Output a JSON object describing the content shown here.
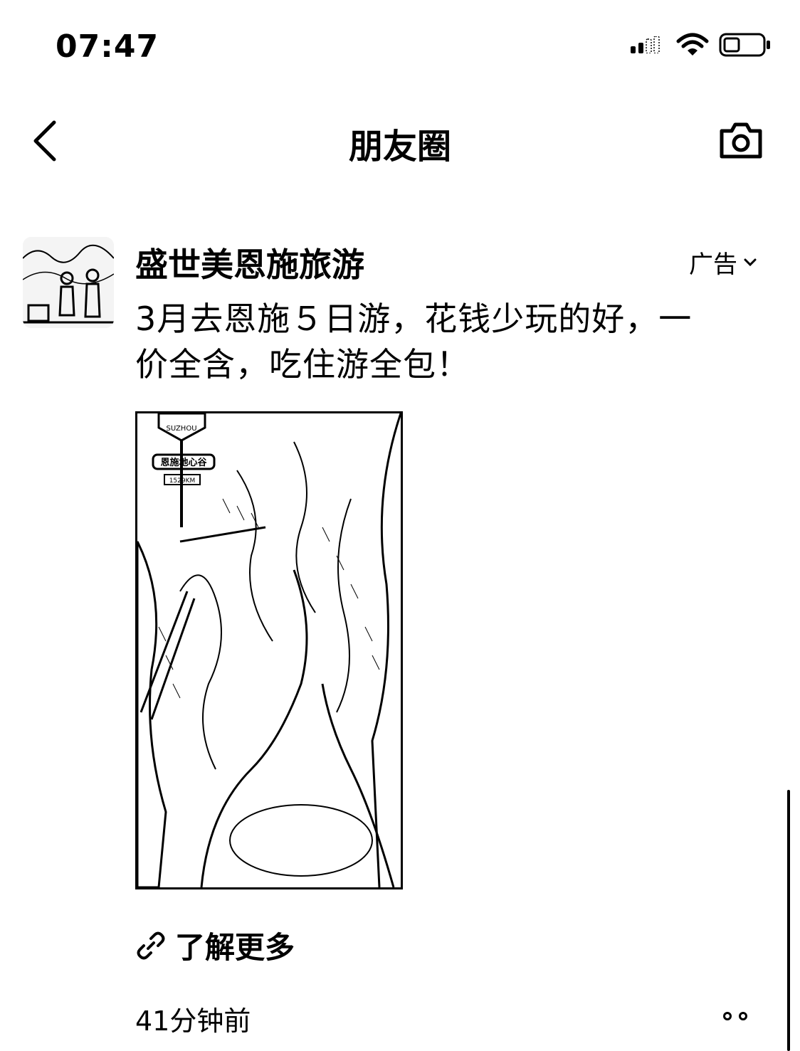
{
  "status_bar": {
    "time": "07:47",
    "signal_icon": "cellular-signal-icon",
    "wifi_icon": "wifi-icon",
    "battery_icon": "battery-icon",
    "battery_level": 0.3
  },
  "nav": {
    "back_icon": "chevron-left-icon",
    "title": "朋友圈",
    "camera_icon": "camera-icon"
  },
  "post": {
    "author": "盛世美恩施旅游",
    "ad_label": "广告",
    "ad_menu_icon": "chevron-down-icon",
    "text_line1": "3月去恩施５日游，花钱少玩的好，一",
    "text_line2": "价全含，吃住游全包！",
    "image": {
      "sign_text": "恩施地心谷",
      "sign_distance": "1529KM",
      "sign_top": "SUZHOU"
    },
    "link_icon": "link-icon",
    "learn_more": "了解更多",
    "timestamp": "41分钟前",
    "more_icon": "more-dots-icon"
  }
}
